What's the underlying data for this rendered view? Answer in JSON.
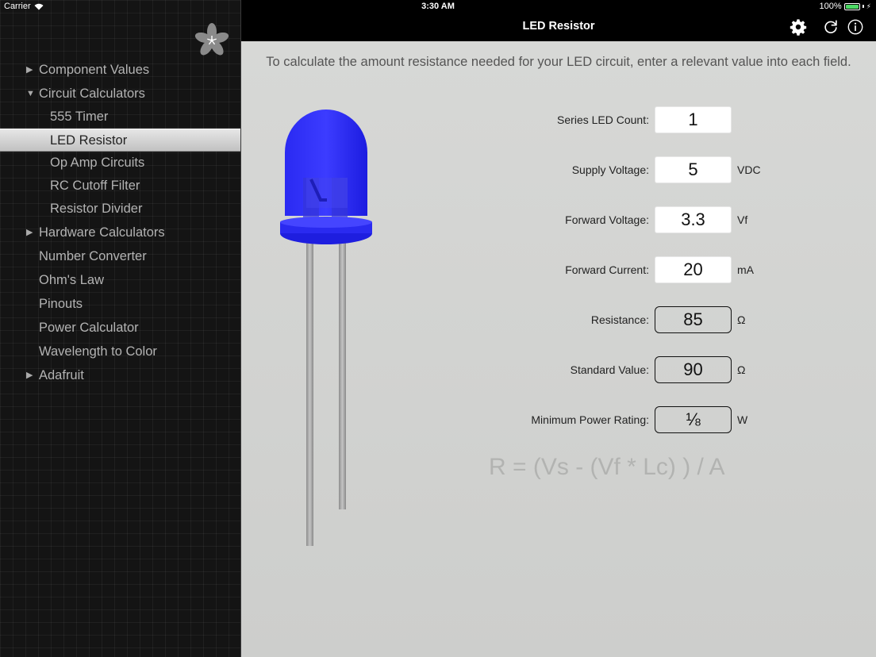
{
  "status_bar": {
    "carrier": "Carrier",
    "time": "3:30 AM",
    "battery": "100%"
  },
  "sidebar": {
    "items": [
      {
        "label": "Component Values",
        "arrow": "▶"
      },
      {
        "label": "Circuit Calculators",
        "arrow": "▼"
      },
      {
        "label": "555 Timer"
      },
      {
        "label": "LED Resistor"
      },
      {
        "label": "Op Amp Circuits"
      },
      {
        "label": "RC Cutoff Filter"
      },
      {
        "label": "Resistor Divider"
      },
      {
        "label": "Hardware Calculators",
        "arrow": "▶"
      },
      {
        "label": "Number Converter"
      },
      {
        "label": "Ohm's Law"
      },
      {
        "label": "Pinouts"
      },
      {
        "label": "Power Calculator"
      },
      {
        "label": "Wavelength to Color"
      },
      {
        "label": "Adafruit",
        "arrow": "▶"
      }
    ]
  },
  "topbar": {
    "title": "LED Resistor"
  },
  "content": {
    "instructions": "To calculate the amount resistance needed for your LED circuit, enter a relevant value into each field.",
    "fields": {
      "series_led_count": {
        "label": "Series LED Count:",
        "value": "1",
        "unit": ""
      },
      "supply_voltage": {
        "label": "Supply Voltage:",
        "value": "5",
        "unit": "VDC"
      },
      "forward_voltage": {
        "label": "Forward Voltage:",
        "value": "3.3",
        "unit": "Vf"
      },
      "forward_current": {
        "label": "Forward Current:",
        "value": "20",
        "unit": "mA"
      },
      "resistance": {
        "label": "Resistance:",
        "value": "85",
        "unit": "Ω"
      },
      "standard_value": {
        "label": "Standard Value:",
        "value": "90",
        "unit": "Ω"
      },
      "min_power_rating": {
        "label": "Minimum Power Rating:",
        "value": "⅛",
        "unit": "W"
      }
    },
    "formula": "R = (Vs - (Vf * Lc) ) / A"
  },
  "colors": {
    "led_blue": "#2222f0",
    "battery_green": "#4cd964",
    "selected_bg": "#d4d4d4"
  }
}
